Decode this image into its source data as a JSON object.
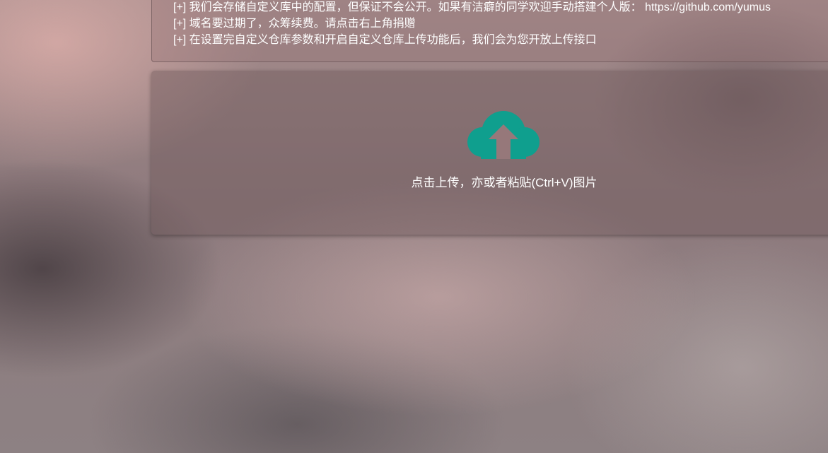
{
  "notice": {
    "lines": [
      "[+] 我们会存储自定义库中的配置，但保证不会公开。如果有洁癖的同学欢迎手动搭建个人版： https://github.com/yumus",
      "[+] 域名要过期了，众筹续费。请点击右上角捐赠",
      "[+] 在设置完自定义仓库参数和开启自定义仓库上传功能后，我们会为您开放上传接口"
    ]
  },
  "upload": {
    "icon": "cloud-upload-icon",
    "icon_color": "#0f9f8e",
    "text": "点击上传，亦或者粘贴(Ctrl+V)图片"
  }
}
